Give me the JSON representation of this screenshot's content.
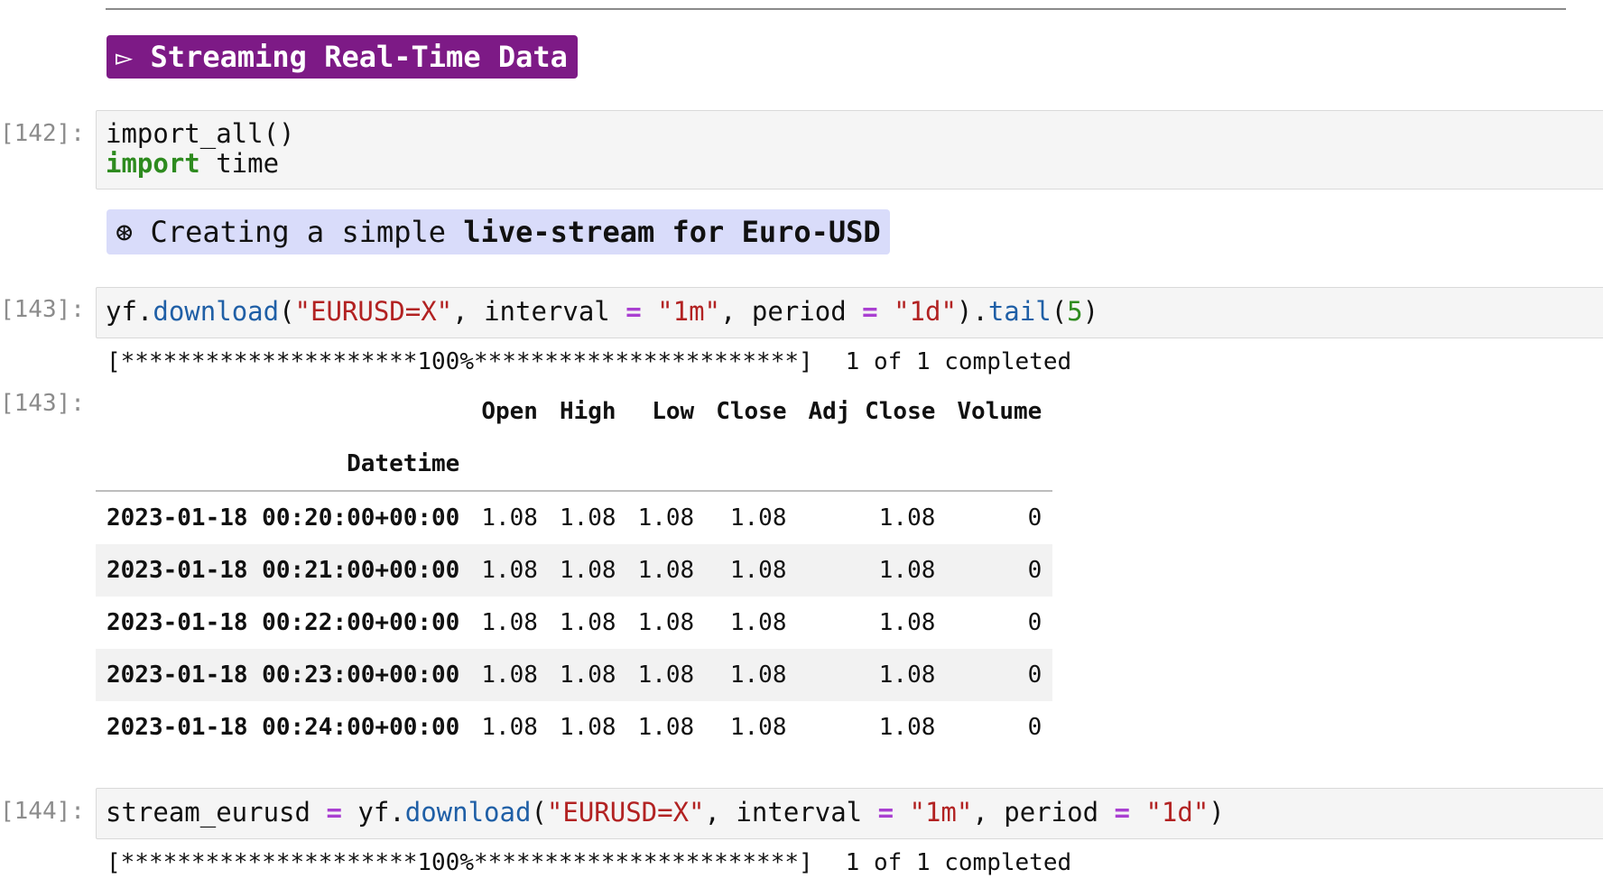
{
  "heading1": {
    "icon": "▻",
    "text": "Streaming Real-Time Data"
  },
  "cells": {
    "c142": {
      "prompt": "[142]:",
      "line1": "import_all()",
      "line2_kw": "import",
      "line2_rest": " time"
    },
    "heading2": {
      "icon": "⊛",
      "pre": " Creating a simple ",
      "bold": "live-stream for Euro-USD"
    },
    "c143": {
      "prompt": "[143]:",
      "code": {
        "p1": "yf.",
        "f1": "download",
        "p2": "(",
        "s1": "\"EURUSD=X\"",
        "p3": ", interval ",
        "o1": "=",
        "p4": " ",
        "s2": "\"1m\"",
        "p5": ", period ",
        "o2": "=",
        "p6": " ",
        "s3": "\"1d\"",
        "p7": ").",
        "f2": "tail",
        "p8": "(",
        "n1": "5",
        "p9": ")"
      },
      "stdout_bar": "[*********************100%***********************]",
      "stdout_tail": "1 of 1 completed",
      "out_prompt": "[143]:",
      "table": {
        "columns": [
          "Open",
          "High",
          "Low",
          "Close",
          "Adj Close",
          "Volume"
        ],
        "index_name": "Datetime",
        "rows": [
          {
            "idx": "2023-01-18 00:20:00+00:00",
            "vals": [
              "1.08",
              "1.08",
              "1.08",
              "1.08",
              "1.08",
              "0"
            ]
          },
          {
            "idx": "2023-01-18 00:21:00+00:00",
            "vals": [
              "1.08",
              "1.08",
              "1.08",
              "1.08",
              "1.08",
              "0"
            ]
          },
          {
            "idx": "2023-01-18 00:22:00+00:00",
            "vals": [
              "1.08",
              "1.08",
              "1.08",
              "1.08",
              "1.08",
              "0"
            ]
          },
          {
            "idx": "2023-01-18 00:23:00+00:00",
            "vals": [
              "1.08",
              "1.08",
              "1.08",
              "1.08",
              "1.08",
              "0"
            ]
          },
          {
            "idx": "2023-01-18 00:24:00+00:00",
            "vals": [
              "1.08",
              "1.08",
              "1.08",
              "1.08",
              "1.08",
              "0"
            ]
          }
        ]
      }
    },
    "c144": {
      "prompt": "[144]:",
      "code": {
        "p1": "stream_eurusd ",
        "o1": "=",
        "p2": " yf.",
        "f1": "download",
        "p3": "(",
        "s1": "\"EURUSD=X\"",
        "p4": ", interval ",
        "o2": "=",
        "p5": " ",
        "s2": "\"1m\"",
        "p6": ", period ",
        "o3": "=",
        "p7": " ",
        "s3": "\"1d\"",
        "p8": ")"
      },
      "stdout_bar": "[*********************100%***********************]",
      "stdout_tail": "1 of 1 completed"
    }
  },
  "colors": {
    "heading1_bg": "#7d1a86",
    "heading2_bg": "#d9dcfa",
    "keyword": "#2e8b1f",
    "function": "#1f5fa6",
    "string": "#b22222",
    "operator": "#a93fd1"
  }
}
